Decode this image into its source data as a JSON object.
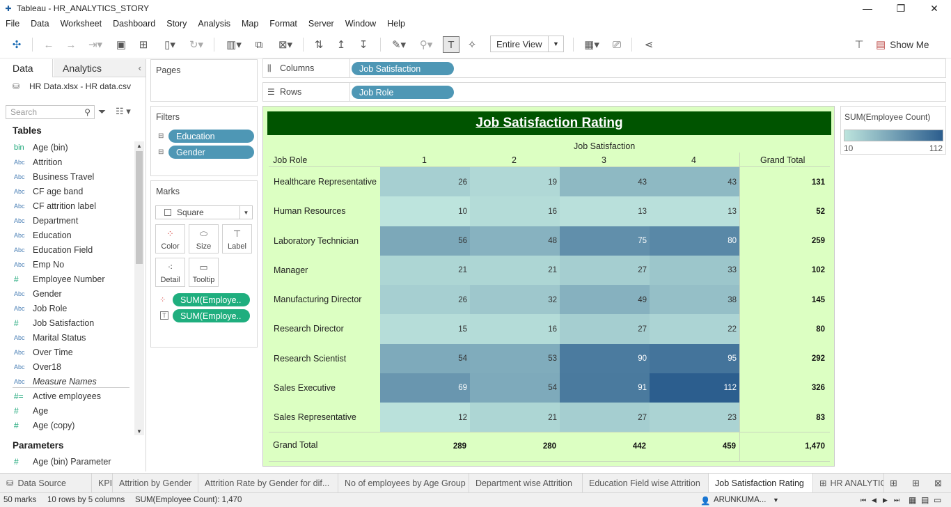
{
  "window": {
    "title": "Tableau - HR_ANALYTICS_STORY"
  },
  "menu": [
    "File",
    "Data",
    "Worksheet",
    "Dashboard",
    "Story",
    "Analysis",
    "Map",
    "Format",
    "Server",
    "Window",
    "Help"
  ],
  "toolbar": {
    "fit": "Entire View",
    "show_me": "Show Me"
  },
  "datapane": {
    "tab_data": "Data",
    "tab_analytics": "Analytics",
    "datasource": "HR Data.xlsx - HR data.csv",
    "search_placeholder": "Search",
    "tables_heading": "Tables",
    "fields": [
      {
        "type": "bin",
        "name": "Age (bin)"
      },
      {
        "type": "Abc",
        "name": "Attrition"
      },
      {
        "type": "Abc",
        "name": "Business Travel"
      },
      {
        "type": "Abc",
        "name": "CF age band"
      },
      {
        "type": "Abc",
        "name": "CF attrition label"
      },
      {
        "type": "Abc",
        "name": "Department"
      },
      {
        "type": "Abc",
        "name": "Education"
      },
      {
        "type": "Abc",
        "name": "Education Field"
      },
      {
        "type": "Abc",
        "name": "Emp No"
      },
      {
        "type": "#",
        "name": "Employee Number"
      },
      {
        "type": "Abc",
        "name": "Gender"
      },
      {
        "type": "Abc",
        "name": "Job Role"
      },
      {
        "type": "#",
        "name": "Job Satisfaction"
      },
      {
        "type": "Abc",
        "name": "Marital Status"
      },
      {
        "type": "Abc",
        "name": "Over Time"
      },
      {
        "type": "Abc",
        "name": "Over18"
      },
      {
        "type": "Abc",
        "name": "Measure Names"
      },
      {
        "type": "#=",
        "name": "Active employees"
      },
      {
        "type": "#",
        "name": "Age"
      },
      {
        "type": "#",
        "name": "Age (copy)"
      }
    ],
    "parameters_heading": "Parameters",
    "parameters": [
      {
        "type": "#",
        "name": "Age (bin) Parameter"
      }
    ]
  },
  "cards": {
    "pages": "Pages",
    "filters": "Filters",
    "filter_pills": [
      "Education",
      "Gender"
    ],
    "marks": "Marks",
    "mark_type": "Square",
    "mark_buttons": [
      "Color",
      "Size",
      "Label",
      "Detail",
      "Tooltip"
    ],
    "mark_pills": [
      "SUM(Employe..",
      "SUM(Employe.."
    ]
  },
  "shelves": {
    "columns_label": "Columns",
    "columns_pill": "Job Satisfaction",
    "rows_label": "Rows",
    "rows_pill": "Job Role"
  },
  "chart_data": {
    "type": "heatmap",
    "title": "Job Satisfaction Rating",
    "column_field": "Job Satisfaction",
    "row_field": "Job Role",
    "columns": [
      "1",
      "2",
      "3",
      "4"
    ],
    "rows": [
      {
        "label": "Healthcare Representative",
        "values": [
          26,
          19,
          43,
          43
        ],
        "total": "131"
      },
      {
        "label": "Human Resources",
        "values": [
          10,
          16,
          13,
          13
        ],
        "total": "52"
      },
      {
        "label": "Laboratory Technician",
        "values": [
          56,
          48,
          75,
          80
        ],
        "total": "259"
      },
      {
        "label": "Manager",
        "values": [
          21,
          21,
          27,
          33
        ],
        "total": "102"
      },
      {
        "label": "Manufacturing Director",
        "values": [
          26,
          32,
          49,
          38
        ],
        "total": "145"
      },
      {
        "label": "Research Director",
        "values": [
          15,
          16,
          27,
          22
        ],
        "total": "80"
      },
      {
        "label": "Research Scientist",
        "values": [
          54,
          53,
          90,
          95
        ],
        "total": "292"
      },
      {
        "label": "Sales Executive",
        "values": [
          69,
          54,
          91,
          112
        ],
        "total": "326"
      },
      {
        "label": "Sales Representative",
        "values": [
          12,
          21,
          27,
          23
        ],
        "total": "83"
      }
    ],
    "grand_total_label": "Grand Total",
    "column_totals": [
      "289",
      "280",
      "442",
      "459"
    ],
    "overall_total": "1,470",
    "color_min": 10,
    "color_max": 112,
    "color_low": "#bde4dd",
    "color_high": "#2c5e8e"
  },
  "legend": {
    "title": "SUM(Employee Count)",
    "min": "10",
    "max": "112"
  },
  "sheet_tabs": [
    "Data Source",
    "KPI",
    "Attrition by Gender",
    "Attrition Rate by Gender for dif...",
    "No of employees by Age Group",
    "Department wise Attrition",
    "Education Field wise Attrition",
    "Job Satisfaction Rating",
    "HR ANALYTIC"
  ],
  "status": {
    "marks": "50 marks",
    "rows_cols": "10 rows by 5 columns",
    "sum": "SUM(Employee Count): 1,470",
    "user": "ARUNKUMA..."
  }
}
